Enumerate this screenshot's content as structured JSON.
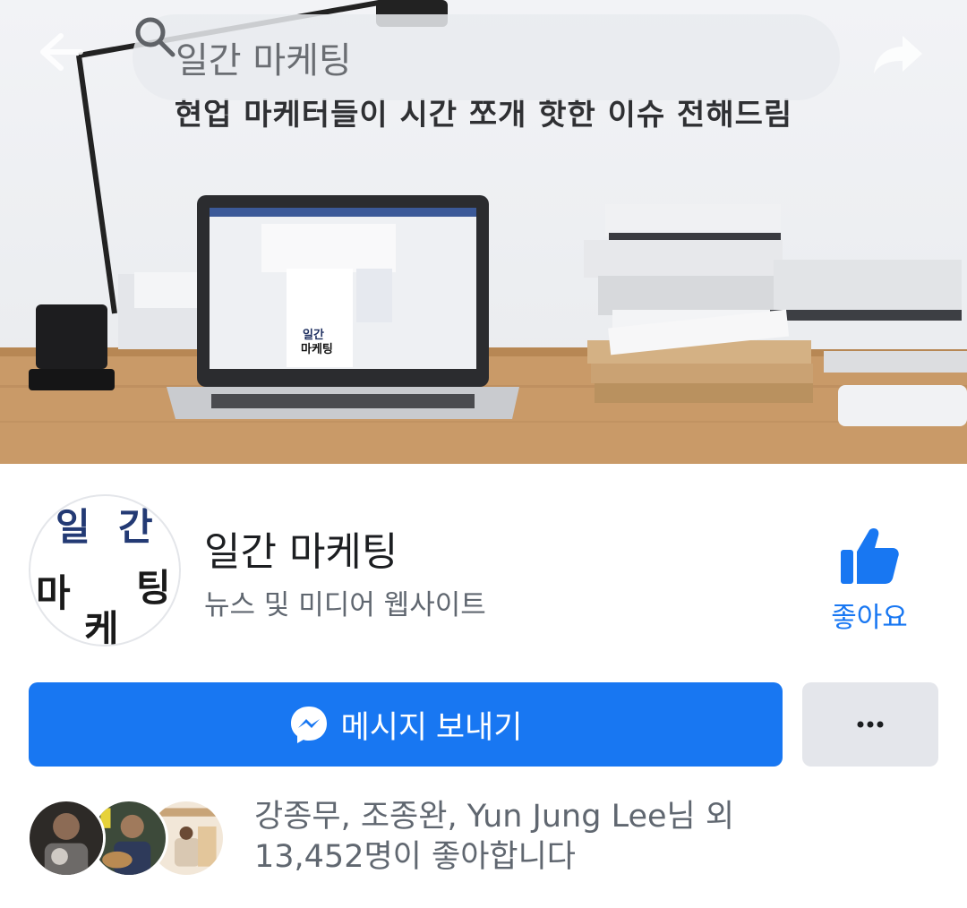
{
  "search": {
    "text": "일간 마케팅"
  },
  "cover": {
    "tagline": "현업 마케터들이 시간 쪼개 핫한 이슈 전해드림"
  },
  "page": {
    "name": "일간 마케팅",
    "category": "뉴스 및 미디어 웹사이트",
    "avatar_chars": [
      "일",
      "간",
      "마",
      "팅",
      "케"
    ]
  },
  "actions": {
    "like_label": "좋아요",
    "message_label": "메시지 보내기"
  },
  "social": {
    "line1": "강종무, 조종완, Yun Jung Lee님 외",
    "line2": "13,452명이 좋아합니다"
  },
  "colors": {
    "accent": "#1877f2",
    "secondary_button": "#e4e6eb",
    "text_primary": "#1c1e21",
    "text_secondary": "#606770"
  },
  "icons": [
    "back-arrow-icon",
    "search-icon",
    "share-arrow-icon",
    "thumbs-up-icon",
    "messenger-icon",
    "more-dots-icon"
  ]
}
